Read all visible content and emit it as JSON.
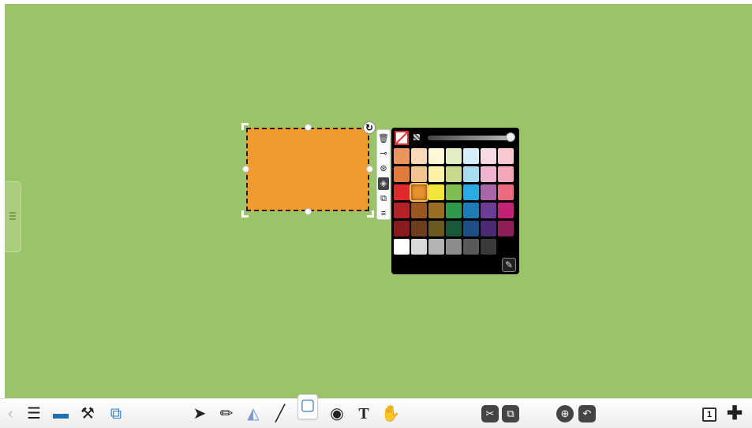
{
  "canvas": {
    "background": "#9bc367"
  },
  "shape": {
    "fill": "#f09a30",
    "border_style": "dashed"
  },
  "shape_tools": {
    "items": [
      {
        "name": "delete-icon",
        "glyph": "🗑"
      },
      {
        "name": "line-style-icon",
        "glyph": "⊸"
      },
      {
        "name": "pattern-icon",
        "glyph": "⊛"
      },
      {
        "name": "fill-icon",
        "glyph": "◈",
        "active": true
      },
      {
        "name": "arrange-icon",
        "glyph": "⧉"
      },
      {
        "name": "menu-icon",
        "glyph": "≡"
      }
    ]
  },
  "palette": {
    "selected": "#e8902e",
    "rows": [
      [
        "#e9955e",
        "#fad9b8",
        "#fdf6d9",
        "#e4eec5",
        "#d5eef8",
        "#f8d9e6",
        "#f9c9d2"
      ],
      [
        "#e27a3c",
        "#f4c48f",
        "#fbf2a5",
        "#c8d98b",
        "#a7dcf1",
        "#efb4cf",
        "#f4a7b6"
      ],
      [
        "#e3282c",
        "#e8902e",
        "#f3e43b",
        "#7ebc4d",
        "#2aace2",
        "#a666a8",
        "#eb6a7f"
      ],
      [
        "#b22227",
        "#9a5520",
        "#9a6d24",
        "#2f9a4a",
        "#1f7bb5",
        "#6c3c96",
        "#c22176"
      ],
      [
        "#8b1a1d",
        "#6e3d1c",
        "#6b5a20",
        "#19593a",
        "#1b4f86",
        "#492a73",
        "#8e1e55"
      ],
      [
        "#ffffff",
        "#d9d9d9",
        "#b3b3b3",
        "#8c8c8c",
        "#595959",
        "#3a3a3a",
        "#000000"
      ]
    ]
  },
  "toolbar": {
    "page_number": "1",
    "text_tool_label": "T"
  }
}
